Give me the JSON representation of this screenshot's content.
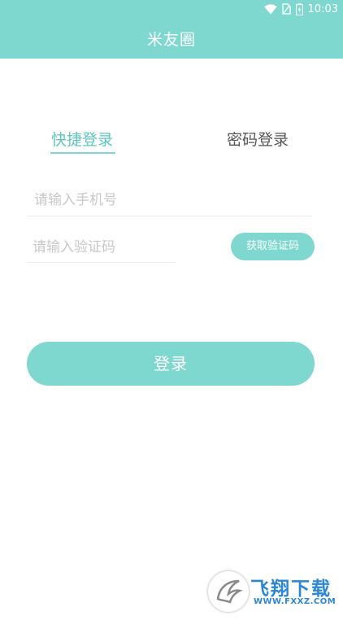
{
  "status_bar": {
    "time": "10:03",
    "icons": [
      "wifi-icon",
      "sim-icon",
      "battery-icon"
    ]
  },
  "header": {
    "title": "米友圈",
    "background_color": "#7fd8cf"
  },
  "tabs": [
    {
      "label": "快捷登录",
      "active": true
    },
    {
      "label": "密码登录",
      "active": false
    }
  ],
  "form": {
    "phone_placeholder": "请输入手机号",
    "phone_value": "",
    "code_placeholder": "请输入验证码",
    "code_value": "",
    "get_code_label": "获取验证码"
  },
  "login_label": "登录",
  "watermark": {
    "text": "飞翔下载",
    "url": "WWW.FXXZ.COM"
  },
  "colors": {
    "accent": "#7fd8cf",
    "active_tab_text": "#5fc6bc",
    "inactive_tab_text": "#555555",
    "placeholder": "#c8c8c8"
  }
}
